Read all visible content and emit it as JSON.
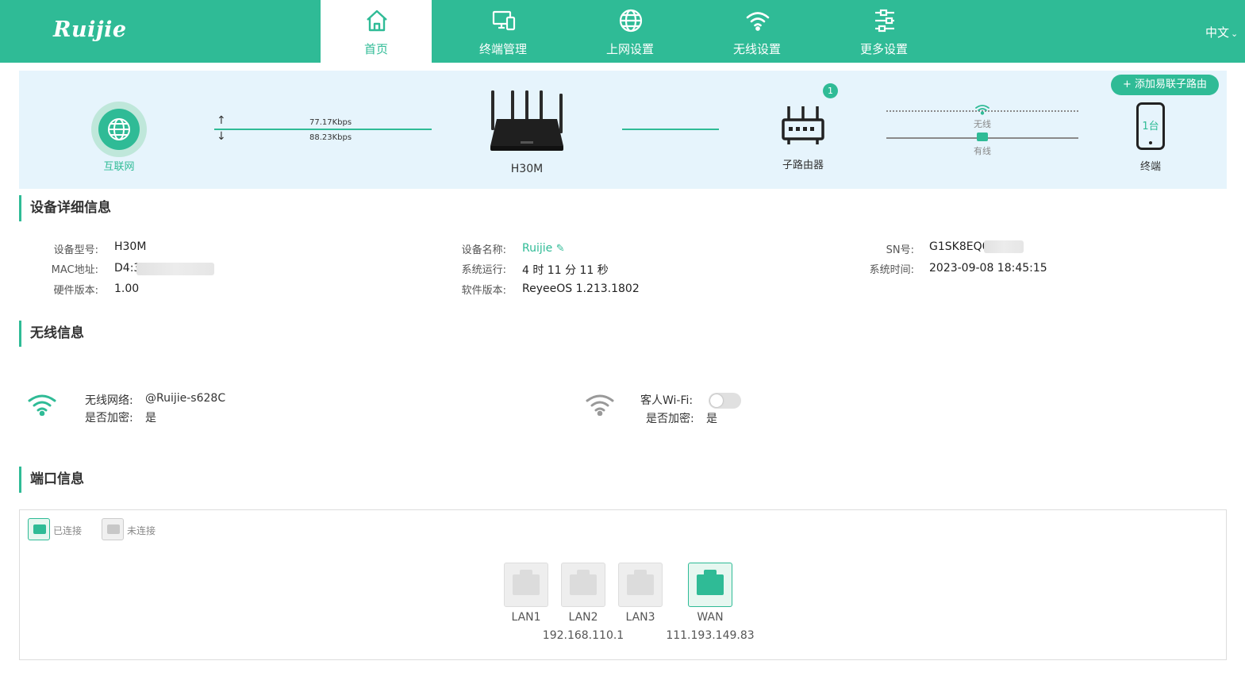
{
  "header": {
    "logo": "Ruijie",
    "nav": [
      {
        "label": "首页",
        "icon": "home-icon",
        "active": true
      },
      {
        "label": "终端管理",
        "icon": "devices-icon"
      },
      {
        "label": "上网设置",
        "icon": "globe-icon"
      },
      {
        "label": "无线设置",
        "icon": "wifi-icon"
      },
      {
        "label": "更多设置",
        "icon": "sliders-icon"
      }
    ],
    "language": "中文"
  },
  "topology": {
    "internet_label": "互联网",
    "upload_speed": "77.17Kbps",
    "download_speed": "88.23Kbps",
    "router_name": "H30M",
    "sub_router_label": "子路由器",
    "sub_router_count": "1",
    "wireless_label": "无线",
    "wired_label": "有线",
    "add_button": "+ 添加易联子路由",
    "terminal_count": "1台",
    "terminal_label": "终端"
  },
  "device_info": {
    "title": "设备详细信息",
    "model_label": "设备型号:",
    "model": "H30M",
    "mac_label": "MAC地址:",
    "mac": "D4:3",
    "hw_label": "硬件版本:",
    "hw": "1.00",
    "name_label": "设备名称:",
    "name": "Ruijie",
    "uptime_label": "系统运行:",
    "uptime": "4 时 11 分 11 秒",
    "sw_label": "软件版本:",
    "sw": "ReyeeOS 1.213.1802",
    "sn_label": "SN号:",
    "sn": "G1SK8EQ0",
    "time_label": "系统时间:",
    "time": "2023-09-08 18:45:15"
  },
  "wireless": {
    "title": "无线信息",
    "net_label": "无线网络:",
    "net": "@Ruijie-s628C",
    "enc_label": "是否加密:",
    "enc": "是",
    "guest_label": "客人Wi-Fi:",
    "guest_enc_label": "是否加密:",
    "guest_enc": "是",
    "guest_enabled": false
  },
  "ports": {
    "title": "端口信息",
    "legend_connected": "已连接",
    "legend_disconnected": "未连接",
    "items": [
      {
        "label": "LAN1",
        "connected": false
      },
      {
        "label": "LAN2",
        "connected": false
      },
      {
        "label": "LAN3",
        "connected": false
      },
      {
        "label": "WAN",
        "connected": true
      }
    ],
    "lan_ip": "192.168.110.1",
    "wan_ip": "111.193.149.83"
  },
  "colors": {
    "accent": "#2fbb96",
    "topology_bg": "#e6f4fc"
  }
}
